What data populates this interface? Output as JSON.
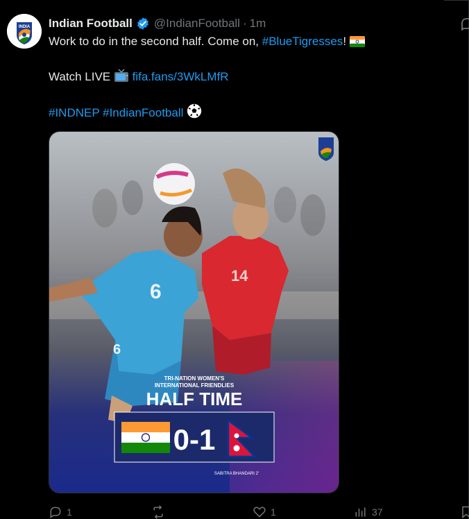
{
  "tweet": {
    "display_name": "Indian Football",
    "handle": "@IndianFootball",
    "separator": "·",
    "time": "1m",
    "line1_text": "Work to do in the second half. Come on,",
    "line1_hashtag": "#BlueTigresses",
    "line1_suffix": "!",
    "line2_text": "Watch LIVE",
    "line2_link": "fifa.fans/3WkLMfR",
    "line3_hashtag1": "#INDNEP",
    "line3_hashtag2": "#IndianFootball",
    "avatar_text": "INDIA",
    "icons": {
      "verified": "verified-badge-icon",
      "tv": "television-icon",
      "football": "soccer-ball-icon",
      "flag": "india-flag-icon"
    }
  },
  "media": {
    "event_line1": "TRI-NATION WOMEN'S",
    "event_line2": "INTERNATIONAL FRIENDLIES",
    "headline": "HALF TIME",
    "score": "0-1",
    "scorer": "SABITRA BHANDARI 2'",
    "badge_text": "INDIA",
    "jersey_left": "6",
    "jersey_right": "14",
    "jersey_left_shorts": "6"
  },
  "actions": {
    "replies": "1",
    "retweets": "",
    "likes": "1",
    "views": "37"
  },
  "colors": {
    "link": "#1d9bf0",
    "muted": "#71767b",
    "background": "#000000",
    "poster_blue": "#1c2a6b"
  }
}
